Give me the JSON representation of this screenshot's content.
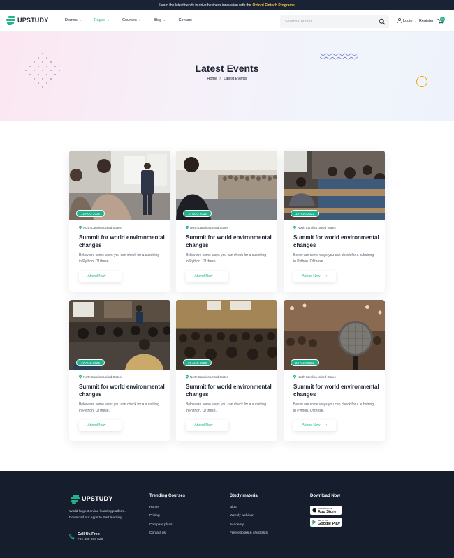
{
  "topbar": {
    "text": "Learn the latest trends in drive business innovation with the",
    "highlight": "Oxford Fintech Programe"
  },
  "brand": {
    "name": "UPSTUDY",
    "accent": "#22b38c"
  },
  "nav": {
    "items": [
      {
        "label": "Demos",
        "dropdown": true,
        "active": false
      },
      {
        "label": "Pages",
        "dropdown": true,
        "active": true
      },
      {
        "label": "Courses",
        "dropdown": true,
        "active": false
      },
      {
        "label": "Blog",
        "dropdown": true,
        "active": false
      },
      {
        "label": "Contact",
        "dropdown": false,
        "active": false
      }
    ],
    "search_placeholder": "Search Courses",
    "login": "Login",
    "register": "Register",
    "cart_count": "0"
  },
  "hero": {
    "title": "Latest Events",
    "breadcrumb_home": "Home",
    "breadcrumb_current": "Latest Events"
  },
  "events": [
    {
      "date": "12 AUG 2022",
      "location": "North Carolina United States",
      "title": "Summit for world environmental changes",
      "description": "Below are some ways you can check for a substring in Python. Of these.",
      "cta": "Attend Now"
    },
    {
      "date": "14 AUG 2022",
      "location": "North Carolina United States",
      "title": "Summit for world environmental changes",
      "description": "Below are some ways you can check for a substring in Python. Of these.",
      "cta": "Attend Now"
    },
    {
      "date": "15 AUG 2022",
      "location": "North Carolina United States",
      "title": "Summit for world environmental changes",
      "description": "Below are some ways you can check for a substring in Python. Of these.",
      "cta": "Attend Now"
    },
    {
      "date": "17 AUG 2022",
      "location": "North Carolina United States",
      "title": "Summit for world environmental changes",
      "description": "Below are some ways you can check for a substring in Python. Of these.",
      "cta": "Attend Now"
    },
    {
      "date": "19 AUG 2022",
      "location": "North Carolina United States",
      "title": "Summit for world environmental changes",
      "description": "Below are some ways you can check for a substring in Python. Of these.",
      "cta": "Attend Now"
    },
    {
      "date": "20 AUG 2022",
      "location": "North Carolina United States",
      "title": "Summit for world environmental changes",
      "description": "Below are some ways you can check for a substring in Python. Of these.",
      "cta": "Attend Now"
    }
  ],
  "footer": {
    "brand": "UPSTUDY",
    "tagline": "World largest online learning platform. Download our apps to start learning.",
    "call_label": "Call Us Free",
    "phone": "+91 458 654 528",
    "trending": {
      "title": "Trending Courses",
      "links": [
        "Home",
        "Pricing",
        "Compare plans",
        "Contact us"
      ]
    },
    "study": {
      "title": "Study material",
      "links": [
        "Blog",
        "Weekly webinar",
        "Academy",
        "Free eBooks & checklists"
      ]
    },
    "download": {
      "title": "Download Now",
      "appstore_top": "Download on the",
      "appstore": "App Store",
      "googleplay_top": "GET IT ON",
      "googleplay": "Google Play"
    }
  }
}
